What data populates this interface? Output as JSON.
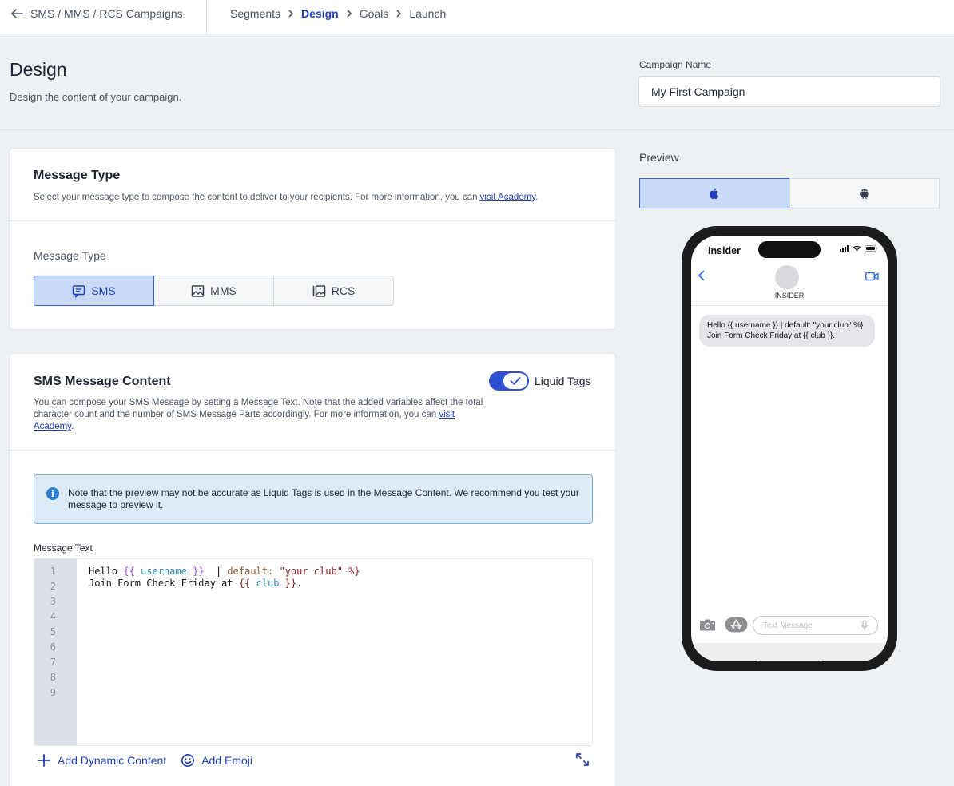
{
  "topbar": {
    "back_label": "SMS / MMS / RCS Campaigns",
    "crumbs": [
      "Segments",
      "Design",
      "Goals",
      "Launch"
    ],
    "active_crumb": "Design"
  },
  "header": {
    "title": "Design",
    "subtitle": "Design the content of your campaign."
  },
  "campaign": {
    "label": "Campaign Name",
    "value": "My First Campaign"
  },
  "message_type_card": {
    "title": "Message Type",
    "desc": "Select your message type to compose the content to deliver to your recipients. For more information, you can ",
    "link": "visit Academy",
    "desc_end": ".",
    "label": "Message Type",
    "options": [
      "SMS",
      "MMS",
      "RCS"
    ],
    "selected": "SMS"
  },
  "content_card": {
    "title": "SMS Message Content",
    "desc": "You can compose your SMS Message by setting a Message Text. Note that the added variables affect the total character count and the number of SMS Message Parts accordingly. For more information, you can ",
    "link": "visit Academy",
    "desc_end": ".",
    "toggle_label": "Liquid Tags",
    "toggle_on": true,
    "notice": "Note that the preview may not be accurate as Liquid Tags is used in the Message Content. We recommend you test your message to preview it.",
    "message_label": "Message Text",
    "line_numbers": [
      "1",
      "2",
      "3",
      "4",
      "5",
      "6",
      "7",
      "8",
      "9"
    ],
    "code": {
      "l1_a": "Hello ",
      "l1_b": "{{",
      "l1_c": " username ",
      "l1_d": "}}",
      "l1_e": "  | ",
      "l1_f": "default: ",
      "l1_g": "\"your club\"",
      "l1_h": " %}",
      "l2_a": "Join Form Check Friday at ",
      "l2_b": "{{",
      "l2_c": " club ",
      "l2_d": "}}",
      "l2_e": "."
    },
    "add_dynamic": "Add Dynamic Content",
    "add_emoji": "Add Emoji"
  },
  "preview": {
    "label": "Preview",
    "platforms": [
      "apple-icon",
      "android-icon"
    ],
    "selected": "apple-icon",
    "phone": {
      "carrier": "Insider",
      "contact": "INSIDER",
      "bubble": "Hello {{ username }}  | default: \"your club\" %} Join Form Check Friday at {{ club }}.",
      "input_placeholder": "Text Message"
    }
  },
  "colors": {
    "accent": "#1f3fb8",
    "selected_bg": "#c9daf8",
    "toggle": "#2f4fd1",
    "notice_bg": "#dcebf6"
  }
}
